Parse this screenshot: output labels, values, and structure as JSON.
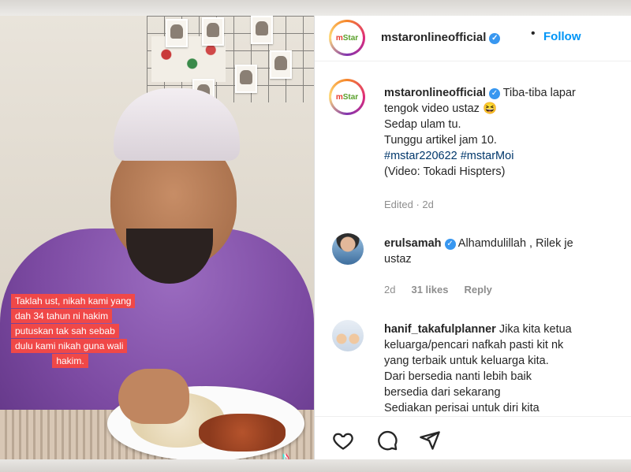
{
  "video": {
    "caption_lines": [
      "Taklah ust, nikah kami yang",
      "dah 34 tahun ni hakim",
      "putuskan tak sah sebab",
      "dulu kami nikah guna wali",
      "hakim."
    ],
    "watermark_icon": "tiktok-icon"
  },
  "header": {
    "avatar_text_left": "m",
    "avatar_text_right": "Star",
    "username": "mstaronlineofficial",
    "separator": "•",
    "follow_label": "Follow"
  },
  "post": {
    "username": "mstaronlineofficial",
    "text_line1": "Tiba-tiba lapar",
    "text_line2": "tengok video ustaz 😆",
    "text_line3": "Sedap ulam tu.",
    "text_line4": "Tunggu artikel jam 10.",
    "hashtag1": "#mstar220622",
    "hashtag2": "#mstarMoi",
    "text_line6": "(Video: Tokadi Hispters)",
    "edited": "Edited · 2d"
  },
  "comments": [
    {
      "username": "erulsamah",
      "text_line1": "Alhamdulillah , Rilek je",
      "text_line2": "ustaz",
      "time": "2d",
      "likes": "31 likes",
      "reply": "Reply"
    },
    {
      "username": "hanif_takafulplanner",
      "text_line1": "Jika kita ketua",
      "text_line2": "keluarga/pencari nafkah pasti kit nk",
      "text_line3": "yang terbaik untuk keluarga kita.",
      "text_line4": "Dari bersedia nanti lebih baik",
      "text_line5": "bersedia dari sekarang",
      "text_line6": "Sediakan perisai untuk diri kita"
    }
  ],
  "actions": [
    "heart-icon",
    "comment-icon",
    "share-icon"
  ],
  "colors": {
    "follow": "#0095f6",
    "caption_bg": "#f04848",
    "verified": "#3897f0",
    "hashtag": "#00376b"
  }
}
